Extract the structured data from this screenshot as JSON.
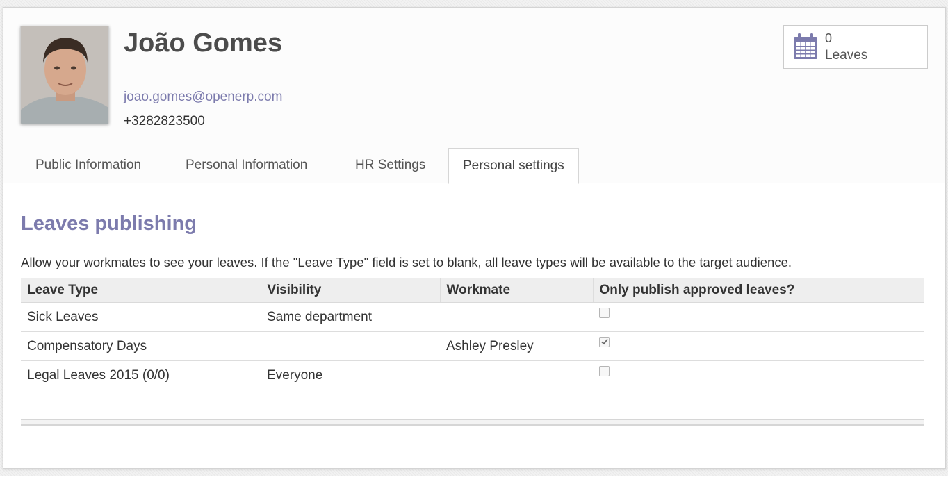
{
  "employee": {
    "name": "João Gomes",
    "email": "joao.gomes@openerp.com",
    "phone": "+3282823500"
  },
  "stat_button": {
    "icon": "calendar-icon",
    "count": "0",
    "label": "Leaves"
  },
  "tabs": [
    {
      "label": "Public Information",
      "active": false
    },
    {
      "label": "Personal Information",
      "active": false
    },
    {
      "label": "HR Settings",
      "active": false
    },
    {
      "label": "Personal settings",
      "active": true
    }
  ],
  "section": {
    "title": "Leaves publishing",
    "help": "Allow your workmates to see your leaves. If the \"Leave Type\" field is set to blank, all leave types will be available to the target audience."
  },
  "table": {
    "headers": [
      "Leave Type",
      "Visibility",
      "Workmate",
      "Only publish approved leaves?"
    ],
    "rows": [
      {
        "leave_type": "Sick Leaves",
        "visibility": "Same department",
        "workmate": "",
        "approved_only": false
      },
      {
        "leave_type": "Compensatory Days",
        "visibility": "",
        "workmate": "Ashley Presley",
        "approved_only": true
      },
      {
        "leave_type": "Legal Leaves 2015 (0/0)",
        "visibility": "Everyone",
        "workmate": "",
        "approved_only": false
      }
    ]
  },
  "colors": {
    "accent": "#7c7bad",
    "header_bg": "#eeeeee"
  }
}
